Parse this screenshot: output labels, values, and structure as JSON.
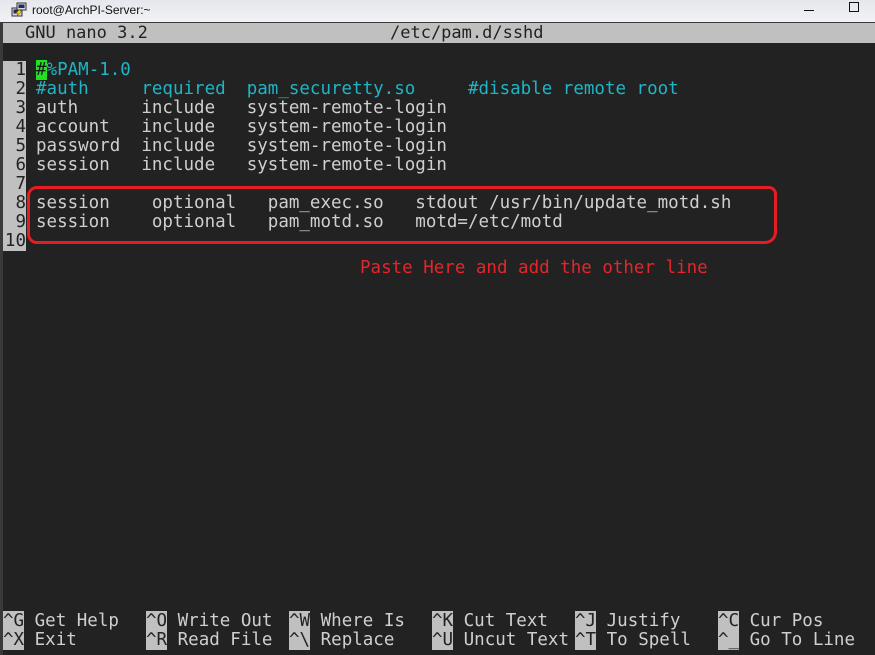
{
  "window": {
    "title": "root@ArchPI-Server:~",
    "icon": "putty-terminal-icon",
    "controls": [
      "minimize",
      "maximize"
    ]
  },
  "nano": {
    "version": "GNU nano 3.2",
    "filename": "/etc/pam.d/sshd"
  },
  "lines": [
    {
      "num": "1",
      "cursor": "#",
      "text": "%PAM-1.0",
      "style": "cyan"
    },
    {
      "num": "2",
      "text": "#auth     required  pam_securetty.so     #disable remote root",
      "style": "cyan"
    },
    {
      "num": "3",
      "text": "auth      include   system-remote-login",
      "style": "normal"
    },
    {
      "num": "4",
      "text": "account   include   system-remote-login",
      "style": "normal"
    },
    {
      "num": "5",
      "text": "password  include   system-remote-login",
      "style": "normal"
    },
    {
      "num": "6",
      "text": "session   include   system-remote-login",
      "style": "normal"
    },
    {
      "num": "7",
      "text": "",
      "style": "normal"
    },
    {
      "num": "8",
      "text": "session    optional   pam_exec.so   stdout /usr/bin/update_motd.sh",
      "style": "normal"
    },
    {
      "num": "9",
      "text": "session    optional   pam_motd.so   motd=/etc/motd",
      "style": "normal"
    },
    {
      "num": "10",
      "text": "",
      "style": "normal"
    }
  ],
  "annotation": {
    "text": "Paste Here and add the other line",
    "color": "#e3262c"
  },
  "shortcuts": [
    {
      "key": "^G",
      "label": "Get Help"
    },
    {
      "key": "^O",
      "label": "Write Out"
    },
    {
      "key": "^W",
      "label": "Where Is"
    },
    {
      "key": "^K",
      "label": "Cut Text"
    },
    {
      "key": "^J",
      "label": "Justify"
    },
    {
      "key": "^C",
      "label": "Cur Pos"
    },
    {
      "key": "^X",
      "label": "Exit"
    },
    {
      "key": "^R",
      "label": "Read File"
    },
    {
      "key": "^\\",
      "label": "Replace"
    },
    {
      "key": "^U",
      "label": "Uncut Text"
    },
    {
      "key": "^T",
      "label": "To Spell"
    },
    {
      "key": "^_",
      "label": "Go To Line"
    }
  ]
}
